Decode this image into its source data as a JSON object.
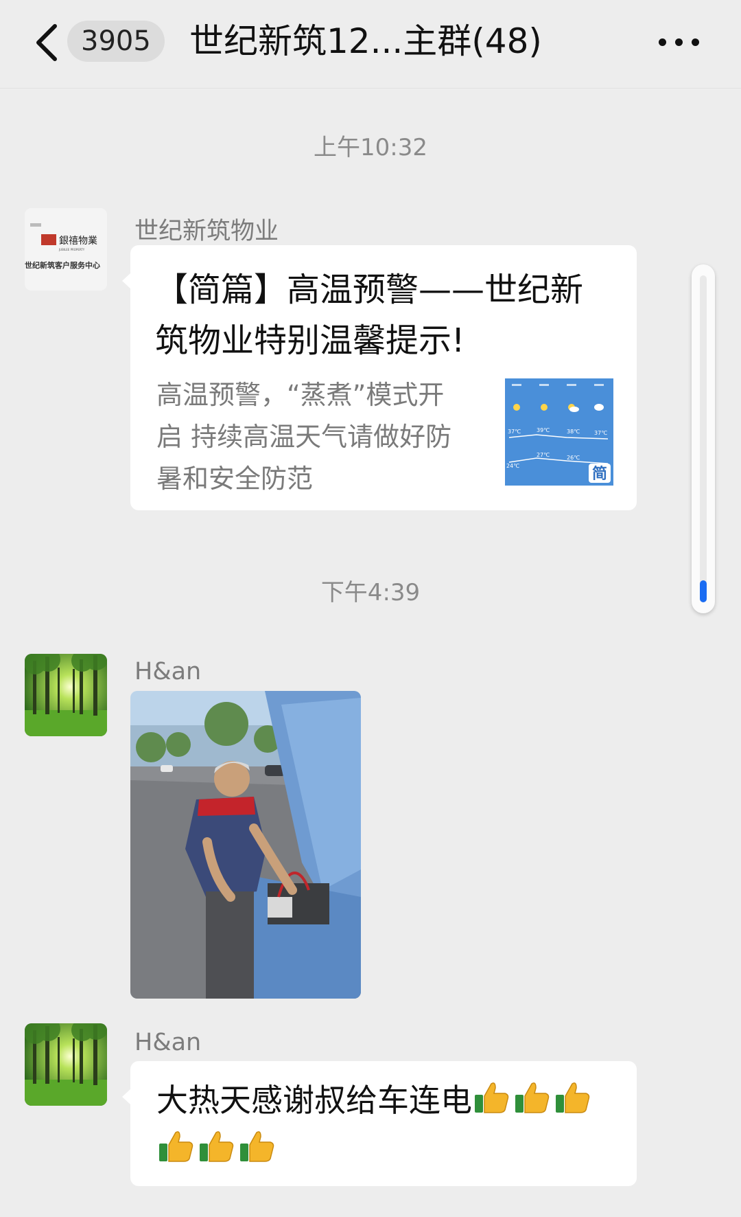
{
  "nav": {
    "unread_count": "3905",
    "title": "世纪新筑12...主群(48)"
  },
  "timestamps": [
    "上午10:32",
    "下午4:39"
  ],
  "messages": [
    {
      "sender": "世纪新筑物业",
      "avatar_text": [
        "銀禧物業",
        "JUBILEE PROPERTY",
        "世纪新筑客户服务中心"
      ],
      "card_title": "【简篇】高温预警——世纪新筑物业特别温馨提示!",
      "card_desc": "高温预警，“蒸煮”模式开启 持续高温天气请做好防暑和安全防范",
      "card_thumb_badge": "简",
      "card_thumb_temps": [
        "37℃",
        "39℃",
        "38℃",
        "37℃",
        "24℃",
        "27℃",
        "26℃"
      ]
    },
    {
      "sender": "H&an",
      "avatar_icon": "forest-avatar-icon",
      "content_type": "image",
      "image_icon": "photo-man-charging-car-battery"
    },
    {
      "sender": "H&an",
      "avatar_icon": "forest-avatar-icon",
      "text": "大热天感谢叔给车连电",
      "emoji_icon": "thumbs-up-icon",
      "emoji_count": 6
    }
  ],
  "colors": {
    "background": "#ededed",
    "bubble": "#ffffff",
    "scroll_accent": "#1a6cf2",
    "thumb_blue": "#4a8fd9"
  }
}
